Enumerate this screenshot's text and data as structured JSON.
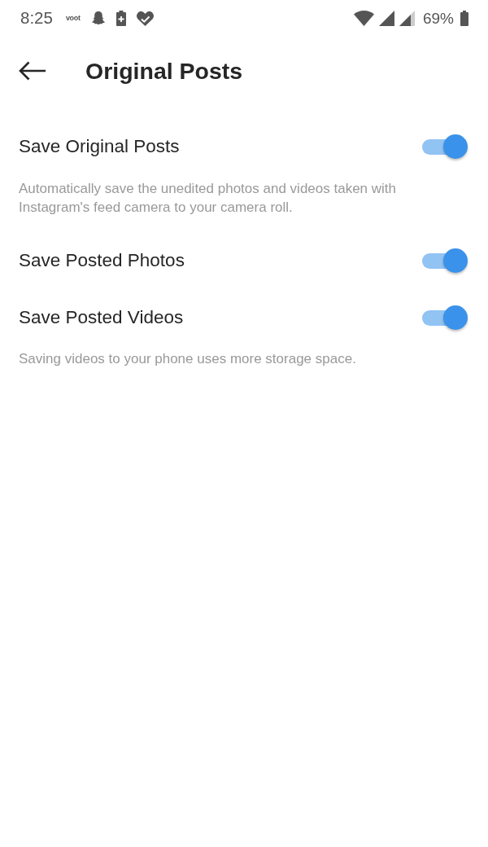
{
  "status_bar": {
    "time": "8:25",
    "app_logo_text": "voot",
    "battery_percent": "69%"
  },
  "header": {
    "title": "Original Posts"
  },
  "settings": [
    {
      "kind": "toggle",
      "label": "Save Original Posts",
      "on": true
    },
    {
      "kind": "note",
      "text": "Automatically save the unedited photos and videos taken with Instagram's feed camera to your camera roll."
    },
    {
      "kind": "toggle",
      "label": "Save Posted Photos",
      "on": true
    },
    {
      "kind": "toggle",
      "label": "Save Posted Videos",
      "on": true
    },
    {
      "kind": "note",
      "text": "Saving videos to your phone uses more storage space."
    }
  ]
}
